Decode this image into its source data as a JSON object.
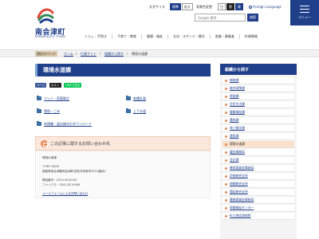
{
  "header": {
    "logo_title": "南会津町",
    "logo_sub": "MINAMIAIZU TOWN",
    "font_size_label": "文字サイズ",
    "font_size_options": [
      "標準",
      "拡大"
    ],
    "bg_color_label": "背景色変更",
    "bg_color_options": [
      "白",
      "黒",
      "青"
    ],
    "foreign_language": "Foreign Language",
    "search_placeholder": "Google 提供",
    "search_button": "検索",
    "menu_label": "メニュー"
  },
  "global_nav": [
    "くらし・手続き",
    "子育て・教育",
    "健康・福祉",
    "文化・スポーツ・観光",
    "産業・事業者",
    "町政情報"
  ],
  "breadcrumb": {
    "current_label": "現在のページ",
    "items": [
      "ホーム",
      "行政サイト",
      "組織から探す",
      "環境水道課"
    ],
    "separator": ">"
  },
  "main": {
    "title": "環境水道課",
    "share": [
      "ページ",
      "ポスト",
      "LINEで送る"
    ],
    "links": [
      "ペット・家畜衛生",
      "各種計画",
      "環境・ごみ",
      "上下水道",
      "申請書・届出様式のダウンロード"
    ]
  },
  "contact": {
    "heading": "この記事に関するお問い合わせ先",
    "department": "環境水道課",
    "postal": "〒967-0004",
    "address": "福島県南会津郡南会津町田島字後原甲3531番地1",
    "phone": "電話番号：0241-62-6140",
    "fax": "ファックス：0241-62-6186",
    "form_link": "メールフォームによるお問い合わせ"
  },
  "sidebar": {
    "heading": "組織から探す",
    "items": [
      "総務課",
      "総合政策課",
      "税務課",
      "住民生活課",
      "健康福祉課",
      "農林課",
      "商工観光課",
      "建設課",
      "環境水道課",
      "議会事務局",
      "会計課",
      "教育委員会事務局",
      "伊南総合支所",
      "南郷総合支所",
      "舘岩総合支所",
      "農業委員会事務局",
      "保健福祉センター",
      "町立南会津病院"
    ],
    "active_index": 8
  },
  "colors": {
    "brand": "#1f3f8a",
    "accent": "#e88a5a",
    "contact_bg": "#fbe8dd"
  }
}
